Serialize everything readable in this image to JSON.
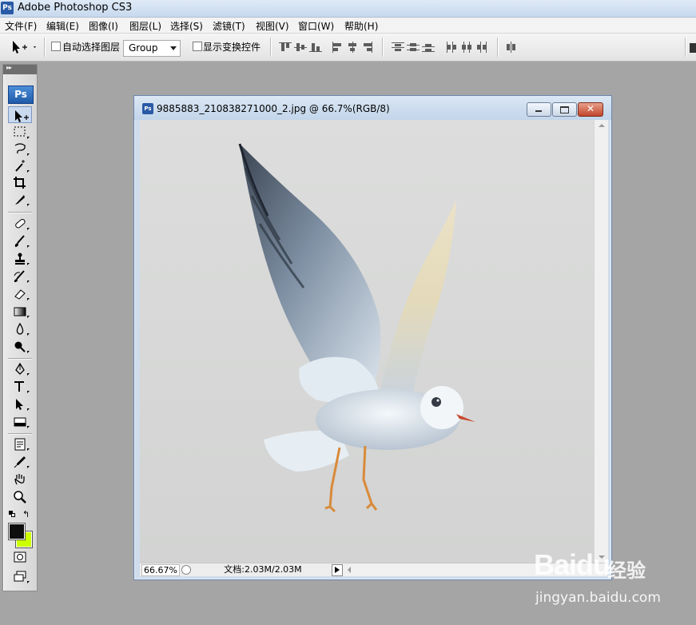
{
  "app": {
    "title": "Adobe Photoshop CS3",
    "logo_text": "Ps"
  },
  "menu": [
    "文件(F)",
    "编辑(E)",
    "图像(I)",
    "图层(L)",
    "选择(S)",
    "滤镜(T)",
    "视图(V)",
    "窗口(W)",
    "帮助(H)"
  ],
  "options": {
    "auto_select_label": "自动选择图层",
    "auto_select_checked": false,
    "auto_select_target": "Group",
    "show_transform_label": "显示变换控件",
    "show_transform_checked": false
  },
  "toolbox": {
    "logo": "Ps",
    "tools": [
      "move-tool",
      "marquee-tool",
      "lasso-tool",
      "magic-wand-tool",
      "crop-tool",
      "slice-tool",
      "healing-brush-tool",
      "brush-tool",
      "clone-stamp-tool",
      "history-brush-tool",
      "eraser-tool",
      "gradient-tool",
      "blur-tool",
      "dodge-tool",
      "pen-tool",
      "type-tool",
      "path-selection-tool",
      "rectangle-tool",
      "notes-tool",
      "eyedropper-tool",
      "hand-tool",
      "zoom-tool"
    ],
    "foreground_color": "#0e0e0e",
    "background_color": "#ccff00"
  },
  "document": {
    "icon_text": "Ps",
    "title": "9885883_210838271000_2.jpg @ 66.7%(RGB/8)",
    "zoom": "66.67%",
    "doc_size": "文档:2.03M/2.03M"
  },
  "watermark": {
    "brand": "Baidu",
    "product": "经验",
    "url": "jingyan.baidu.com"
  }
}
